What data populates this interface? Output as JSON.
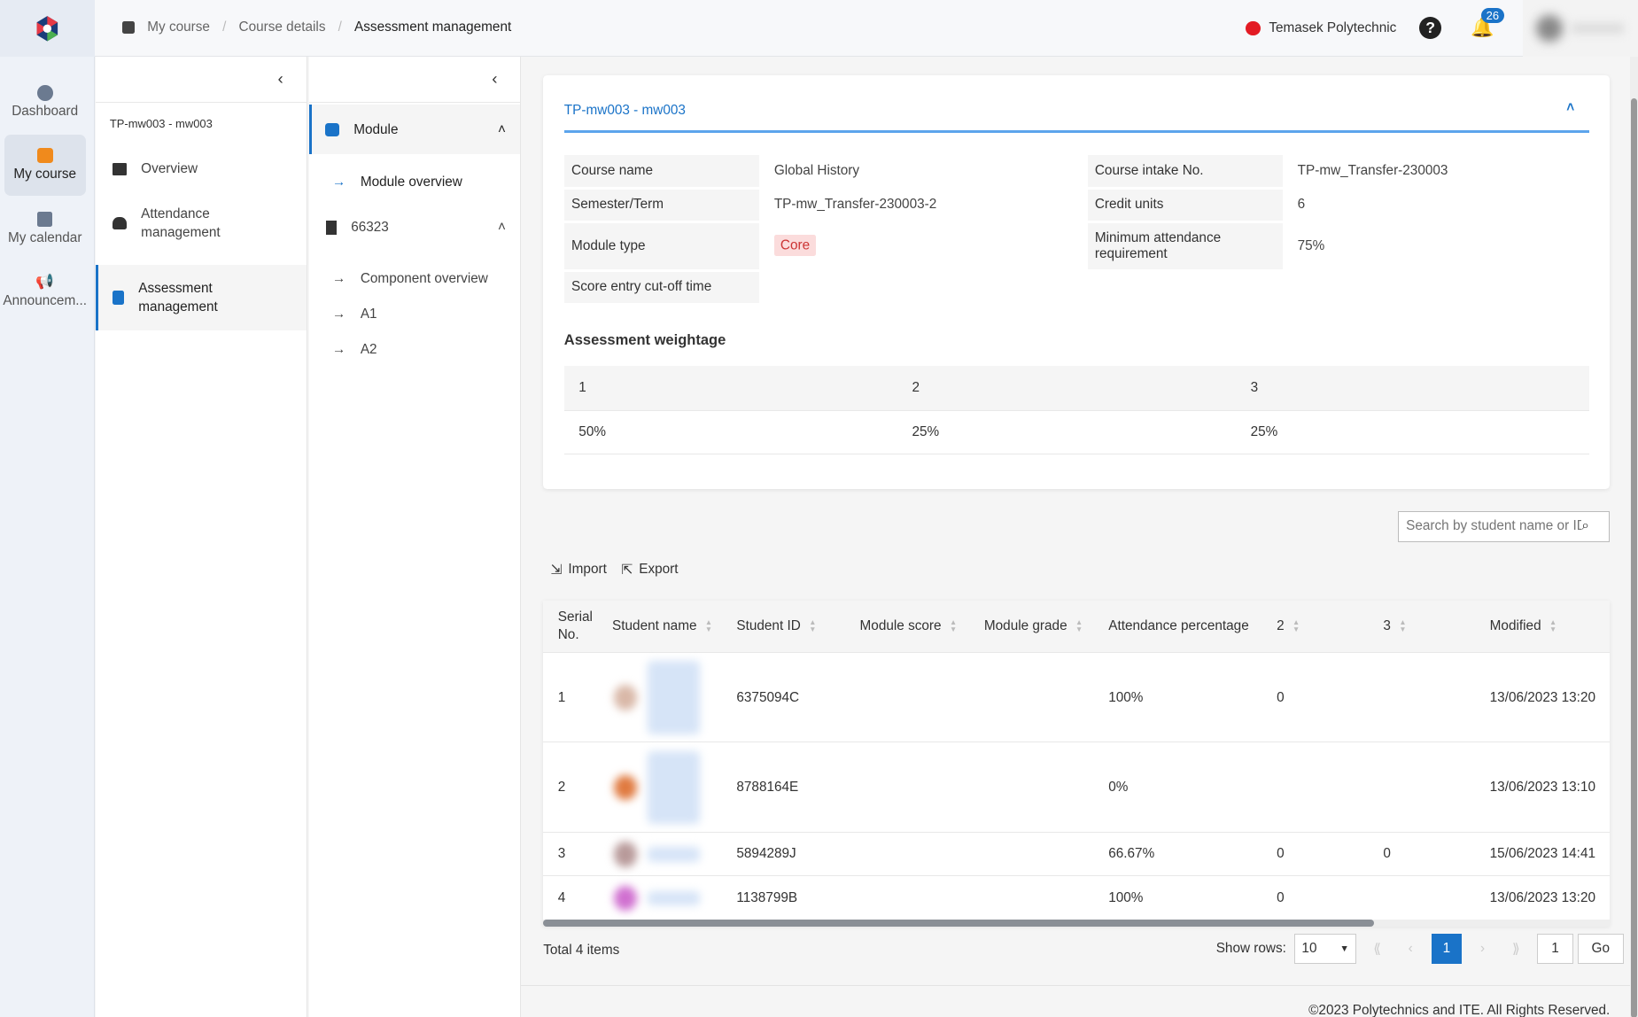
{
  "breadcrumb": {
    "items": [
      "My course",
      "Course details",
      "Assessment management"
    ]
  },
  "header": {
    "institution": "Temasek Polytechnic",
    "notification_count": "26"
  },
  "rail": {
    "items": [
      {
        "label": "Dashboard"
      },
      {
        "label": "My course"
      },
      {
        "label": "My calendar"
      },
      {
        "label": "Announcem..."
      }
    ]
  },
  "panel1": {
    "course_code": "TP-mw003 - mw003",
    "items": [
      {
        "label": "Overview"
      },
      {
        "label": "Attendance management"
      },
      {
        "label": "Assessment management"
      }
    ]
  },
  "panel2": {
    "module": "Module",
    "module_overview": "Module overview",
    "group": "66323",
    "items": [
      "Component overview",
      "A1",
      "A2"
    ]
  },
  "card": {
    "title": "TP-mw003 - mw003",
    "fields": {
      "course_name_label": "Course name",
      "course_name": "Global History",
      "intake_label": "Course intake No.",
      "intake": "TP-mw_Transfer-230003",
      "semester_label": "Semester/Term",
      "semester": "TP-mw_Transfer-230003-2",
      "credit_label": "Credit units",
      "credit": "6",
      "module_type_label": "Module type",
      "module_type": "Core",
      "min_att_label": "Minimum attendance requirement",
      "min_att": "75%",
      "cutoff_label": "Score entry cut-off time"
    },
    "weightage_title": "Assessment weightage",
    "weightage": {
      "headers": [
        "1",
        "2",
        "3"
      ],
      "values": [
        "50%",
        "25%",
        "25%"
      ]
    }
  },
  "search": {
    "placeholder": "Search by student name or ID"
  },
  "actions": {
    "import": "Import",
    "export": "Export"
  },
  "table": {
    "headers": [
      "Serial No.",
      "Student name",
      "Student ID",
      "Module score",
      "Module grade",
      "Attendance percentage",
      "2",
      "3",
      "Modified"
    ],
    "rows": [
      {
        "serial": "1",
        "id": "6375094C",
        "score": "",
        "grade": "",
        "att": "100%",
        "c2": "0",
        "c3": "",
        "modified": "13/06/2023 13:20"
      },
      {
        "serial": "2",
        "id": "8788164E",
        "score": "",
        "grade": "",
        "att": "0%",
        "c2": "",
        "c3": "",
        "modified": "13/06/2023 13:10"
      },
      {
        "serial": "3",
        "id": "5894289J",
        "score": "",
        "grade": "",
        "att": "66.67%",
        "c2": "0",
        "c3": "0",
        "modified": "15/06/2023 14:41"
      },
      {
        "serial": "4",
        "id": "1138799B",
        "score": "",
        "grade": "",
        "att": "100%",
        "c2": "0",
        "c3": "",
        "modified": "13/06/2023 13:20"
      }
    ]
  },
  "pagination": {
    "total": "Total 4 items",
    "show_rows_label": "Show rows:",
    "rows_value": "10",
    "current_page": "1",
    "goto_value": "1",
    "go_label": "Go"
  },
  "footer": {
    "copyright": "©2023 Polytechnics and ITE. All Rights Reserved."
  },
  "colors": {
    "accent": "#1a73c8",
    "core_badge": "#fbdcdc"
  }
}
